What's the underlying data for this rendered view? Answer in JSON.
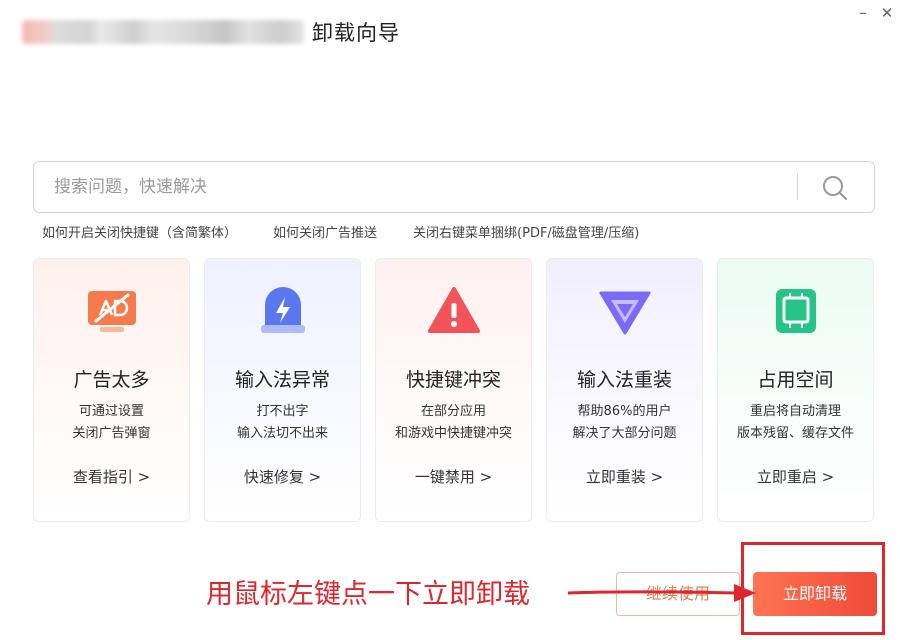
{
  "window": {
    "title": "卸载向导",
    "minimize_glyph": "–",
    "close_glyph": "✕"
  },
  "search": {
    "placeholder": "搜索问题，快速解决",
    "icon": "search-icon"
  },
  "hot_links": [
    "如何开启关闭快捷键（含简繁体）",
    "如何关闭广告推送",
    "关闭右键菜单捆绑(PDF/磁盘管理/压缩)"
  ],
  "cards": [
    {
      "icon": "no-ads-icon",
      "title": "广告太多",
      "desc": [
        "可通过设置",
        "关闭广告弹窗"
      ],
      "link": "查看指引 >",
      "accent": "#f57a4c"
    },
    {
      "icon": "lightning-icon",
      "title": "输入法异常",
      "desc": [
        "打不出字",
        "输入法切不出来"
      ],
      "link": "快速修复 >",
      "accent": "#5b77f0"
    },
    {
      "icon": "warning-icon",
      "title": "快捷键冲突",
      "desc": [
        "在部分应用",
        "和游戏中快捷键冲突"
      ],
      "link": "一键禁用 >",
      "accent": "#f2535a"
    },
    {
      "icon": "reinstall-icon",
      "title": "输入法重装",
      "desc": [
        "帮助86%的用户",
        "解决了大部分问题"
      ],
      "link": "立即重装 >",
      "accent": "#7b6af5"
    },
    {
      "icon": "storage-icon",
      "title": "占用空间",
      "desc": [
        "重启将自动清理",
        "版本残留、缓存文件"
      ],
      "link": "立即重启 >",
      "accent": "#26c486"
    }
  ],
  "buttons": {
    "continue": "继续使用",
    "uninstall": "立即卸载"
  },
  "annotation": {
    "text": "用鼠标左键点一下立即卸载",
    "color": "#e0262c"
  }
}
